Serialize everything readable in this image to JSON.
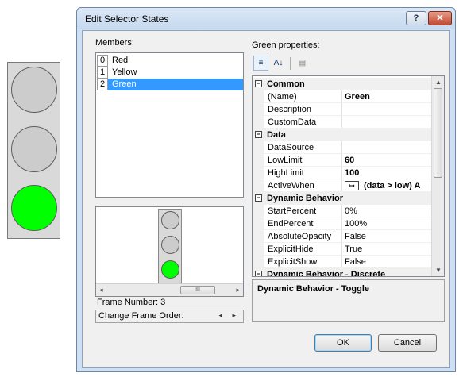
{
  "traffic_light": {
    "lamps": [
      {
        "state": "off",
        "color": "#cccccc"
      },
      {
        "state": "off",
        "color": "#cccccc"
      },
      {
        "state": "on",
        "color": "#00ff00"
      }
    ]
  },
  "dialog": {
    "title": "Edit Selector States",
    "help_label": "?",
    "close_label": "✕",
    "members_label": "Members:",
    "members": [
      {
        "index": "0",
        "name": "Red",
        "selected": false
      },
      {
        "index": "1",
        "name": "Yellow",
        "selected": false
      },
      {
        "index": "2",
        "name": "Green",
        "selected": true
      }
    ],
    "preview": {
      "lamps": [
        "#cccccc",
        "#cccccc",
        "#00ff00"
      ],
      "scroll_left": "◂",
      "scroll_right": "▸",
      "thumb_grip": "III"
    },
    "frame_number": "Frame Number: 3",
    "change_frame_order": "Change Frame Order:",
    "change_frame_arrows": "◂ ▸",
    "properties_label": "Green properties:",
    "toolbar": {
      "categorized_icon": "≡",
      "alphabetical_icon": "A↓",
      "property_pages_icon": "▤"
    },
    "property_grid": {
      "rows": [
        {
          "kind": "category",
          "label": "Common",
          "expander": "−"
        },
        {
          "kind": "prop",
          "name": "(Name)",
          "value": "Green",
          "bold": true
        },
        {
          "kind": "prop",
          "name": "Description",
          "value": "",
          "bold": false
        },
        {
          "kind": "prop",
          "name": "CustomData",
          "value": "",
          "bold": false
        },
        {
          "kind": "category",
          "label": "Data",
          "expander": "−"
        },
        {
          "kind": "prop",
          "name": "DataSource",
          "value": "",
          "bold": false
        },
        {
          "kind": "prop",
          "name": "LowLimit",
          "value": "60",
          "bold": true
        },
        {
          "kind": "prop",
          "name": "HighLimit",
          "value": "100",
          "bold": true
        },
        {
          "kind": "activewhen",
          "name": "ActiveWhen",
          "icon": "↦",
          "value": "(data > low) A"
        },
        {
          "kind": "category",
          "label": "Dynamic Behavior",
          "expander": "−"
        },
        {
          "kind": "prop",
          "name": "StartPercent",
          "value": "0%",
          "bold": false
        },
        {
          "kind": "prop",
          "name": "EndPercent",
          "value": "100%",
          "bold": false
        },
        {
          "kind": "prop",
          "name": "AbsoluteOpacity",
          "value": "False",
          "bold": false
        },
        {
          "kind": "prop",
          "name": "ExplicitHide",
          "value": "True",
          "bold": false
        },
        {
          "kind": "prop",
          "name": "ExplicitShow",
          "value": "False",
          "bold": false
        },
        {
          "kind": "category",
          "label": "Dynamic Behavior - Discrete",
          "expander": "−"
        }
      ],
      "scroll_up": "▲",
      "scroll_down": "▼"
    },
    "description_title": "Dynamic Behavior - Toggle",
    "ok_label": "OK",
    "cancel_label": "Cancel"
  }
}
